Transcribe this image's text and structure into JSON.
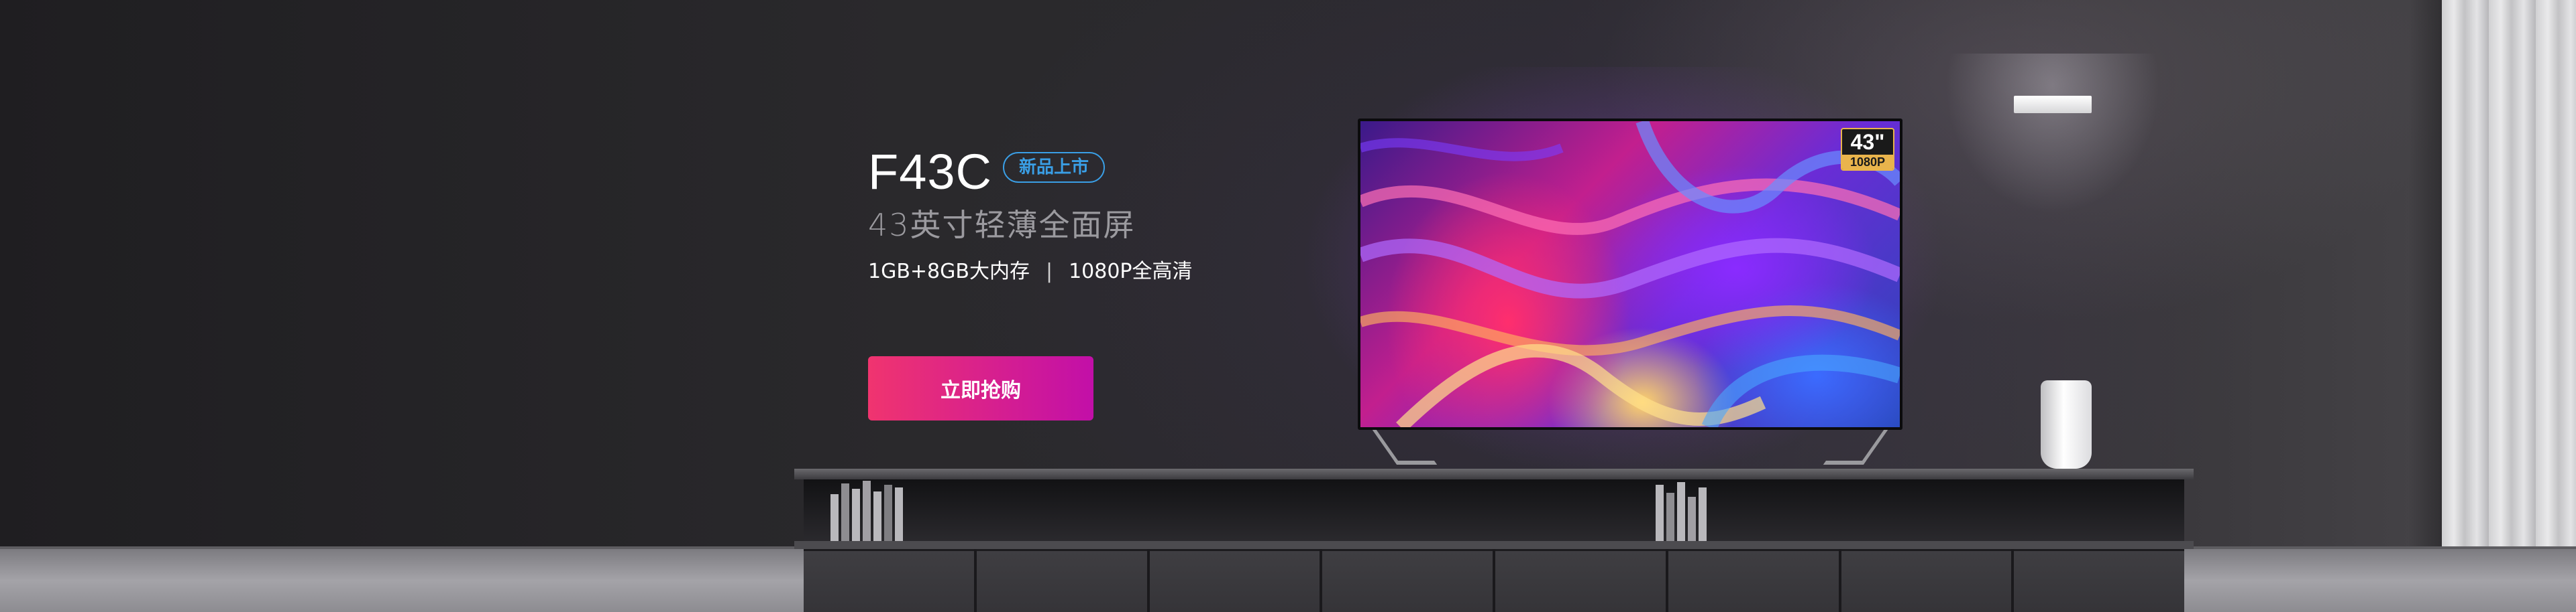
{
  "hero": {
    "model": "F43C",
    "tag": "新品上市",
    "subtitle": "43英寸轻薄全面屏",
    "spec_memory": "1GB+8GB大内存",
    "spec_separator": "|",
    "spec_resolution": "1080P全高清",
    "buy_label": "立即抢购"
  },
  "tv_badge": {
    "size": "43\"",
    "resolution": "1080P"
  },
  "colors": {
    "tag_accent": "#3a9fe6",
    "button_gradient_start": "#f0346f",
    "button_gradient_end": "#c20fa8",
    "badge_gold": "#e9b44c"
  }
}
